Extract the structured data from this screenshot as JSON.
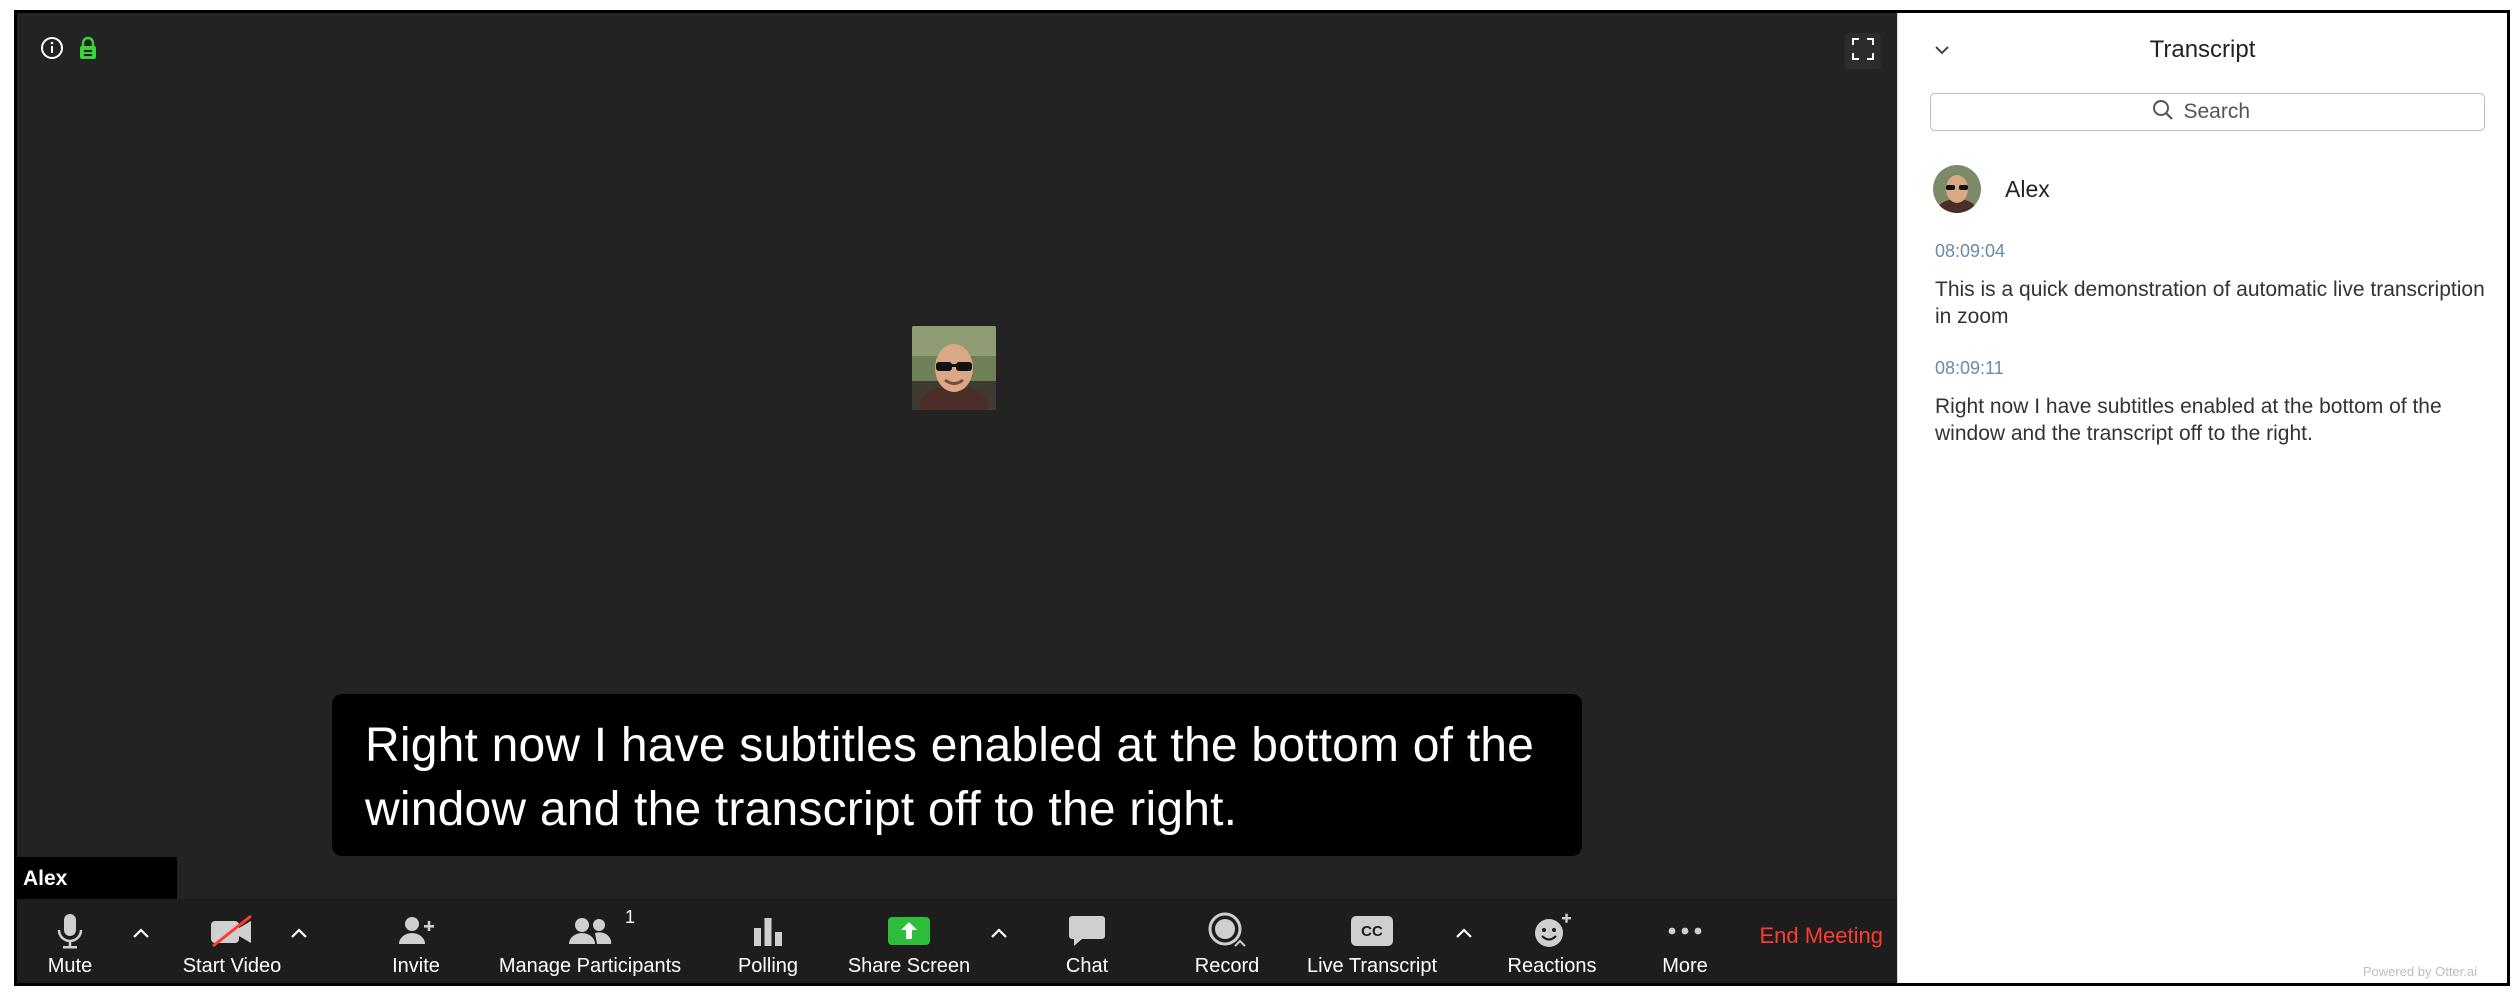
{
  "video": {
    "participant_name": "Alex",
    "subtitle": "Right now I have subtitles enabled at the bottom of the window and the transcript off to the right."
  },
  "toolbar": {
    "mute_label": "Mute",
    "start_video_label": "Start Video",
    "invite_label": "Invite",
    "manage_participants_label": "Manage Participants",
    "participant_count": "1",
    "polling_label": "Polling",
    "share_screen_label": "Share Screen",
    "chat_label": "Chat",
    "record_label": "Record",
    "live_transcript_label": "Live Transcript",
    "cc_badge": "CC",
    "reactions_label": "Reactions",
    "more_label": "More",
    "end_meeting_label": "End Meeting"
  },
  "transcript": {
    "title": "Transcript",
    "search_placeholder": "Search",
    "speaker": "Alex",
    "entries": [
      {
        "time": "08:09:04",
        "text": "This is a quick demonstration of automatic live transcription in zoom"
      },
      {
        "time": "08:09:11",
        "text": "Right now I have subtitles enabled at the bottom of the window and the transcript off to the right."
      }
    ],
    "powered_by": "Powered by Otter.ai"
  },
  "colors": {
    "video_bg": "#232323",
    "toolbar_bg": "#1d1d1d",
    "share_green": "#2dbd3a",
    "end_meeting_red": "#ff3b30",
    "lock_green": "#3bd13b",
    "timestamp_blue": "#6b8aa8"
  },
  "icons": {
    "info": "info-icon",
    "lock": "lock-icon",
    "fullscreen": "fullscreen-icon",
    "mute": "microphone-icon",
    "video": "video-off-icon",
    "invite": "add-person-icon",
    "participants": "people-icon",
    "polling": "bar-chart-icon",
    "share": "share-screen-icon",
    "chat": "chat-bubble-icon",
    "record": "record-icon",
    "transcript": "cc-icon",
    "reactions": "smiley-icon",
    "more": "ellipsis-icon"
  }
}
